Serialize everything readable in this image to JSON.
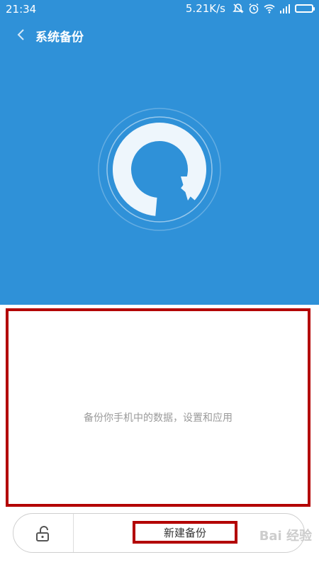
{
  "status_bar": {
    "time": "21:34",
    "speed": "5.21K/s",
    "icons": [
      "mute-icon",
      "alarm-icon",
      "wifi-icon",
      "signal-icon",
      "battery-icon"
    ]
  },
  "header": {
    "title": "系统备份",
    "back_icon": "chevron-left-icon"
  },
  "hero": {
    "icon": "backup-cycle-icon",
    "background_color": "#2f91d8"
  },
  "main": {
    "description": "备份你手机中的数据，设置和应用"
  },
  "bottom_bar": {
    "lock_icon": "unlock-icon",
    "new_backup_label": "新建备份"
  },
  "watermark": {
    "text": "Bai 经验"
  },
  "colors": {
    "accent": "#2f91d8",
    "highlight": "#b30000"
  }
}
